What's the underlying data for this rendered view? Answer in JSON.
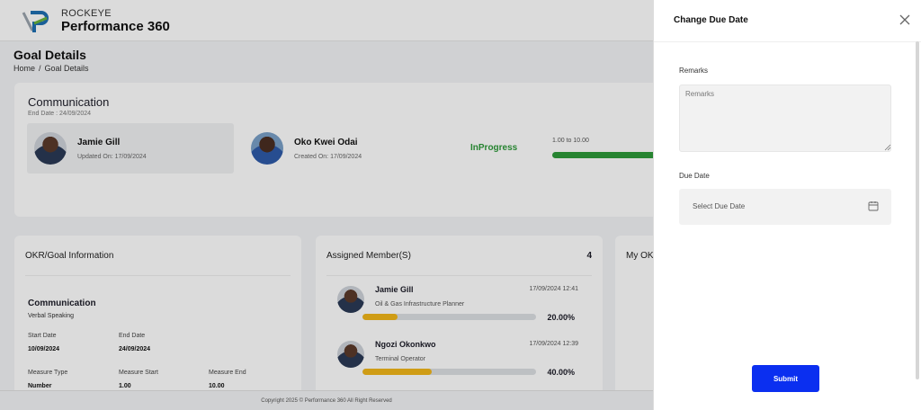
{
  "brand": {
    "small": "ROCKEYE",
    "big": "Performance 360"
  },
  "page": {
    "title": "Goal Details",
    "breadcrumb": {
      "home": "Home",
      "sep": "/",
      "current": "Goal Details"
    }
  },
  "goal": {
    "title": "Communication",
    "end_date": "End Date : 24/09/2024",
    "people": [
      {
        "name": "Jamie Gill",
        "sub": "Updated On: 17/09/2024"
      },
      {
        "name": "Oko Kwei Odai",
        "sub": "Created On: 17/09/2024"
      }
    ],
    "status": "InProgress",
    "range": "1.00 to 10.00",
    "status_color": "#2e9a3a"
  },
  "info": {
    "heading": "OKR/Goal Information",
    "title": "Communication",
    "subtitle": "Verbal Speaking",
    "start_label": "Start Date",
    "start_value": "10/09/2024",
    "end_label": "End Date",
    "end_value": "24/09/2024",
    "measure_type_label": "Measure Type",
    "measure_type_value": "Number",
    "measure_start_label": "Measure Start",
    "measure_start_value": "1.00",
    "measure_end_label": "Measure End",
    "measure_end_value": "10.00"
  },
  "assigned": {
    "heading": "Assigned Member(S)",
    "count": "4",
    "members": [
      {
        "name": "Jamie Gill",
        "role": "Oil & Gas Infrastructure Planner",
        "date": "17/09/2024 12:41",
        "pct": "20.00%",
        "progress": 0.2
      },
      {
        "name": "Ngozi Okonkwo",
        "role": "Terminal Operator",
        "date": "17/09/2024 12:39",
        "pct": "40.00%",
        "progress": 0.4
      }
    ],
    "bar_color": "#f2b619"
  },
  "okr_card": {
    "heading": "My OK"
  },
  "footer": "Copyright 2025 © Performance 360 All Right Reserved",
  "drawer": {
    "title": "Change Due Date",
    "remarks_label": "Remarks",
    "remarks_placeholder": "Remarks",
    "due_label": "Due Date",
    "due_placeholder": "Select Due Date",
    "submit": "Submit",
    "accent": "#0b2ff0"
  }
}
